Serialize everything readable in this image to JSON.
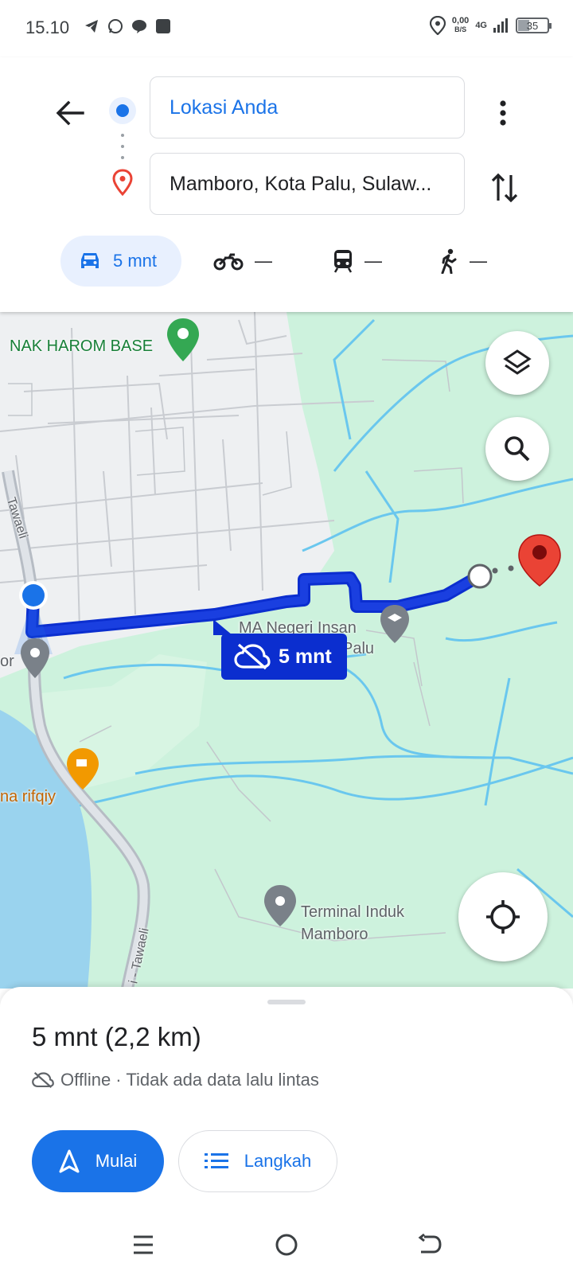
{
  "status_bar": {
    "time": "15.10",
    "net_speed": "0,00",
    "net_unit": "B/S",
    "network": "4G",
    "battery": "35"
  },
  "header": {
    "origin": "Lokasi Anda",
    "destination": "Mamboro, Kota Palu, Sulaw..."
  },
  "modes": {
    "car": "5 mnt",
    "motorcycle": "—",
    "transit": "—",
    "walk": "—"
  },
  "map": {
    "labels": {
      "base": "NAK HAROM BASE",
      "school_line1": "MA Negeri Insan",
      "school_line2": "Palu",
      "cafe": "na rifqiy",
      "terminal_line1": "Terminal Induk",
      "terminal_line2": "Mamboro",
      "road1": "Tawaeli",
      "road2": "i - Tawaeli",
      "left_edge": "or"
    },
    "eta_bubble": "5 mnt",
    "colors": {
      "route": "#1a3fe0",
      "water": "#9ad3ee",
      "park": "#cdf2dd",
      "destination_pin": "#ea4335"
    }
  },
  "sheet": {
    "summary": "5 mnt (2,2 km)",
    "traffic_note": "Offline · Tidak ada data lalu lintas",
    "start_label": "Mulai",
    "steps_label": "Langkah"
  },
  "icons": {
    "back": "arrow-left-icon",
    "more": "more-vert-icon",
    "swap": "swap-vert-icon",
    "car": "car-icon",
    "motorcycle": "motorcycle-icon",
    "transit": "train-icon",
    "walk": "walk-icon",
    "layers": "layers-icon",
    "search": "search-icon",
    "locate": "my-location-icon",
    "offline": "cloud-off-icon",
    "navigate": "navigation-icon",
    "list": "list-icon"
  }
}
